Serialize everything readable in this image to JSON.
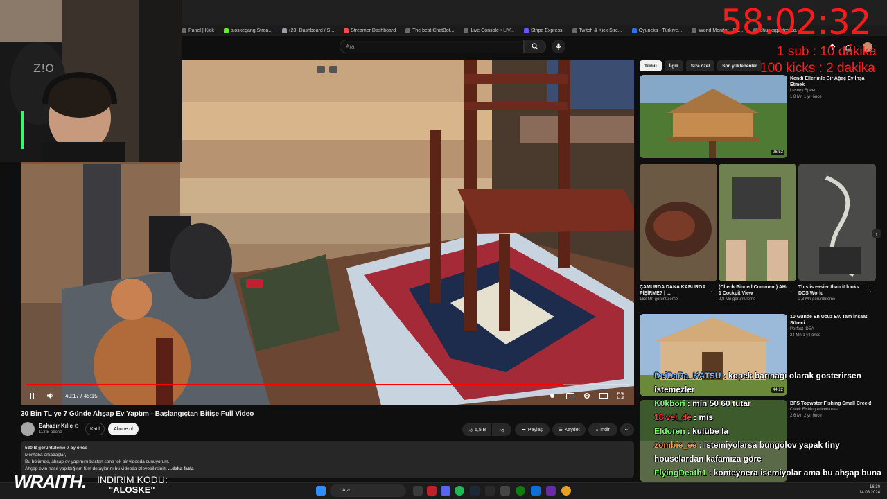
{
  "bookmarks": [
    "Panel | Kick",
    "aloskegang Strea...",
    "(23) Dashboard / S...",
    "Streamer Dashboard",
    "The best ChatBot...",
    "Live Console • LIV...",
    "Stripe Express",
    "Twitch & Kick Stre...",
    "Oyuneks - Türkiye...",
    "World Monitor - Re...",
    "chucksguides.co..."
  ],
  "search": {
    "placeholder": "Ara"
  },
  "player": {
    "time": "40:17 / 45:15",
    "progress": 0.89
  },
  "video": {
    "title": "30 Bin TL ye 7 Günde Ahşap Ev Yaptım - Başlangıçtan Bitişe Full Video",
    "channel": "Bahadır Kılıç",
    "subscribers": "113 B abone",
    "join_label": "Katıl",
    "subscribe_label": "Abone ol",
    "likes": "6,5 B",
    "share_label": "Paylaş",
    "save_label": "Kaydet",
    "download_label": "İndir"
  },
  "description": {
    "meta": "530 B görüntüleme  7 ay önce",
    "line1": "Merhaba arkadaşlar,",
    "line2": "Bu bölümde, ahşap ev yapımını baştan sona tek bir videoda sunuyorum.",
    "line3": "Ahşap evin nasıl yapıldığının tüm detaylarını bu videoda izleyebilirsiniz.",
    "more": "...daha fazla"
  },
  "chips": [
    "Tümü",
    "İlgili",
    "Size özel",
    "Son yüklenenler"
  ],
  "recommendations": [
    {
      "title": "Kendi Ellerimle Bir Ağaç Ev İnşa Etmek",
      "channel": "Lesnoy Speed",
      "meta": "1,8 Mn  1 yıl önce",
      "duration": "26:52"
    },
    {
      "title": "10 Günde En Ucuz Ev. Tam İnşaat Süreci",
      "channel": "Perfect IDEA",
      "meta": "24 Mn  1 yıl önce",
      "duration": "44:22"
    },
    {
      "title": "BFS Topwater Fishing Small Creek!",
      "channel": "Creek Fishing Adventures",
      "meta": "2,6 Mn  2 yıl önce",
      "duration": ""
    }
  ],
  "shorts": [
    {
      "title": "ÇAMURDA DANA KABURGA PİŞİRME? | ...",
      "views": "183 Mn görüntüleme"
    },
    {
      "title": "(Check Pinned Comment) AH-1 Cockpit View",
      "views": "2,8 Mn görüntüleme"
    },
    {
      "title": "This is easier than it looks | DCS World",
      "views": "2,3 Mn görüntüleme"
    }
  ],
  "overlay": {
    "timer": "58:02:32",
    "rule1": "1 sub : 10 dakika",
    "rule2": "100 kicks : 2 dakika",
    "promo_brand": "WRAITH.",
    "promo_label": "İNDİRİM KODU:",
    "promo_code": "\"ALOSKE\""
  },
  "chat": [
    {
      "user": "DeiDaRa_KATSU",
      "user_color": "#6fb7ff",
      "text": ": kopek barınagı olarak gosterirsen istemezler"
    },
    {
      "user": "K0kbori",
      "user_color": "#7dff6a",
      "text": ": min 50 60 tutar"
    },
    {
      "user": "18 vei_de",
      "user_color": "#ff3b3b",
      "text": ": mis"
    },
    {
      "user": "Eldoren",
      "user_color": "#7dff6a",
      "text": ": kulübe la"
    },
    {
      "user": "zombie_ee",
      "user_color": "#ff9f2e",
      "text": ": istemiyolarsa bungolov yapak tiny houselardan kafamıza göre"
    },
    {
      "user": "FlyingDeath1",
      "user_color": "#7dff6a",
      "text": ": konteynera isemiyolar ama bu ahşap buna isterler sanırım"
    }
  ],
  "taskbar": {
    "search_placeholder": "Ara",
    "time": "16:30",
    "date": "14.08.2024"
  }
}
